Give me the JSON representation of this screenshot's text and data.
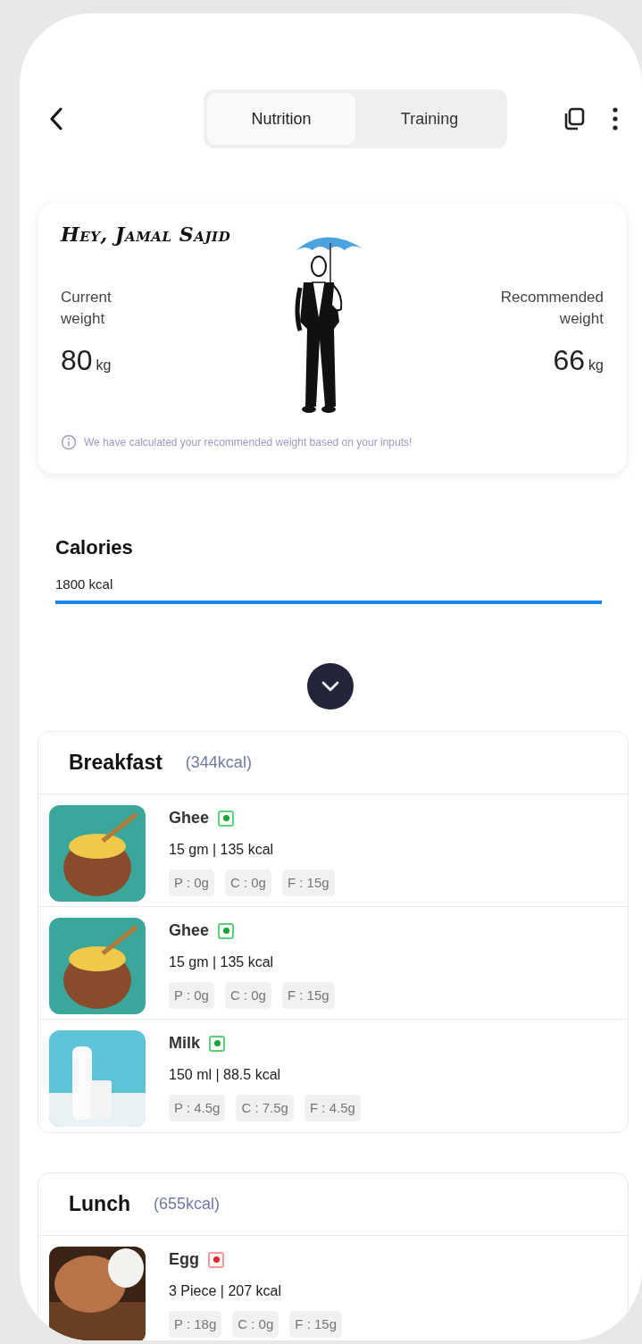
{
  "tabs": [
    {
      "label": "Nutrition",
      "selected": true
    },
    {
      "label": "Training",
      "selected": false
    }
  ],
  "profile": {
    "greeting": "Hey, Jamal Sajid",
    "current_label": "Current weight",
    "current_value": "80",
    "current_unit": "kg",
    "recommended_label": "Recommended weight",
    "recommended_value": "66",
    "recommended_unit": "kg",
    "note": "We have calculated your recommended weight based on your inputs!"
  },
  "calories": {
    "title": "Calories",
    "value": "1800 kcal"
  },
  "meals": [
    {
      "name": "Breakfast",
      "total": "(344kcal)",
      "items": [
        {
          "name": "Ghee",
          "veg": true,
          "kind": "ghee",
          "amount": "15 gm | 135 kcal",
          "macros": [
            "P : 0g",
            "C : 0g",
            "F : 15g"
          ]
        },
        {
          "name": "Ghee",
          "veg": true,
          "kind": "ghee",
          "amount": "15 gm | 135 kcal",
          "macros": [
            "P : 0g",
            "C : 0g",
            "F : 15g"
          ]
        },
        {
          "name": "Milk",
          "veg": true,
          "kind": "milk",
          "amount": "150 ml | 88.5 kcal",
          "macros": [
            "P : 4.5g",
            "C : 7.5g",
            "F : 4.5g"
          ]
        }
      ]
    },
    {
      "name": "Lunch",
      "total": "(655kcal)",
      "items": [
        {
          "name": "Egg",
          "veg": false,
          "kind": "egg",
          "amount": "3 Piece | 207 kcal",
          "macros": [
            "P : 18g",
            "C : 0g",
            "F : 15g"
          ]
        }
      ]
    }
  ]
}
